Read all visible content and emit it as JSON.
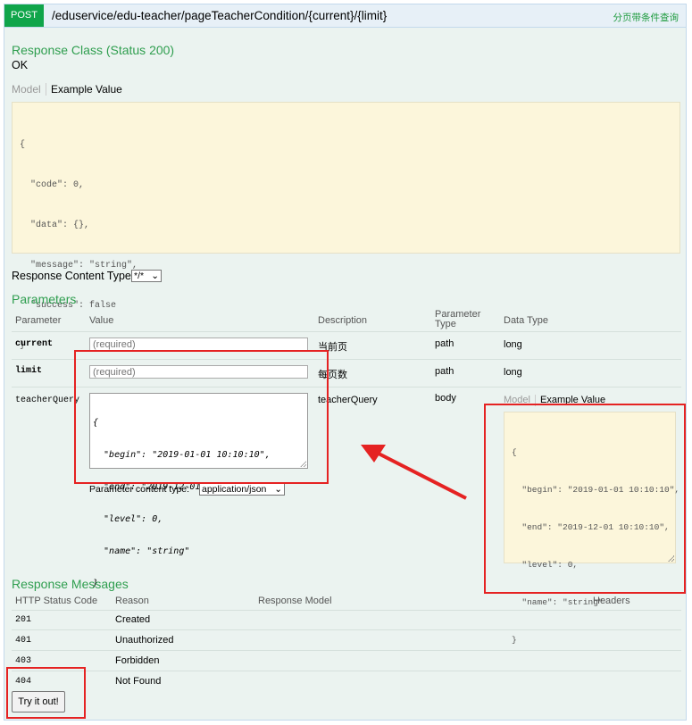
{
  "endpoint": {
    "method": "POST",
    "path": "/eduservice/edu-teacher/pageTeacherCondition/{current}/{limit}",
    "summary": "分页带条件查询"
  },
  "response_class": {
    "title": "Response Class (Status 200)",
    "status_text": "OK",
    "tabs": {
      "model": "Model",
      "example": "Example Value"
    },
    "example_lines": [
      "{",
      "  \"code\": 0,",
      "  \"data\": {},",
      "  \"message\": \"string\",",
      "  \"success\": false",
      "}"
    ]
  },
  "content_type": {
    "label": "Response Content Type",
    "value": "*/*"
  },
  "parameters": {
    "title": "Parameters",
    "columns": [
      "Parameter",
      "Value",
      "Description",
      "Parameter Type",
      "Data Type"
    ],
    "rows": [
      {
        "name": "current",
        "placeholder": "(required)",
        "description": "当前页",
        "type": "path",
        "data_type": "long"
      },
      {
        "name": "limit",
        "placeholder": "(required)",
        "description": "每页数",
        "type": "path",
        "data_type": "long"
      },
      {
        "name": "teacherQuery",
        "description": "teacherQuery",
        "type": "body"
      }
    ],
    "body_textarea_lines": [
      "{",
      "  \"begin\": \"2019-01-01 10:10:10\",",
      "  \"end\": \"2019-12-01 10:10:10\",",
      "  \"level\": 0,",
      "  \"name\": \"string\"",
      "}"
    ],
    "content_type_label": "Parameter content type:",
    "content_type_value": "application/json",
    "datatype_tabs": {
      "model": "Model",
      "example": "Example Value"
    },
    "datatype_example_lines": [
      "{",
      "  \"begin\": \"2019-01-01 10:10:10\",",
      "  \"end\": \"2019-12-01 10:10:10\",",
      "  \"level\": 0,",
      "  \"name\": \"string\"",
      "}"
    ]
  },
  "response_messages": {
    "title": "Response Messages",
    "columns": [
      "HTTP Status Code",
      "Reason",
      "Response Model",
      "Headers"
    ],
    "rows": [
      {
        "code": "201",
        "reason": "Created"
      },
      {
        "code": "401",
        "reason": "Unauthorized"
      },
      {
        "code": "403",
        "reason": "Forbidden"
      },
      {
        "code": "404",
        "reason": "Not Found"
      }
    ]
  },
  "try_button": "Try it out!",
  "colors": {
    "method": "#10a54a",
    "annotation": "#e52222",
    "heading": "#2f9e4f"
  }
}
